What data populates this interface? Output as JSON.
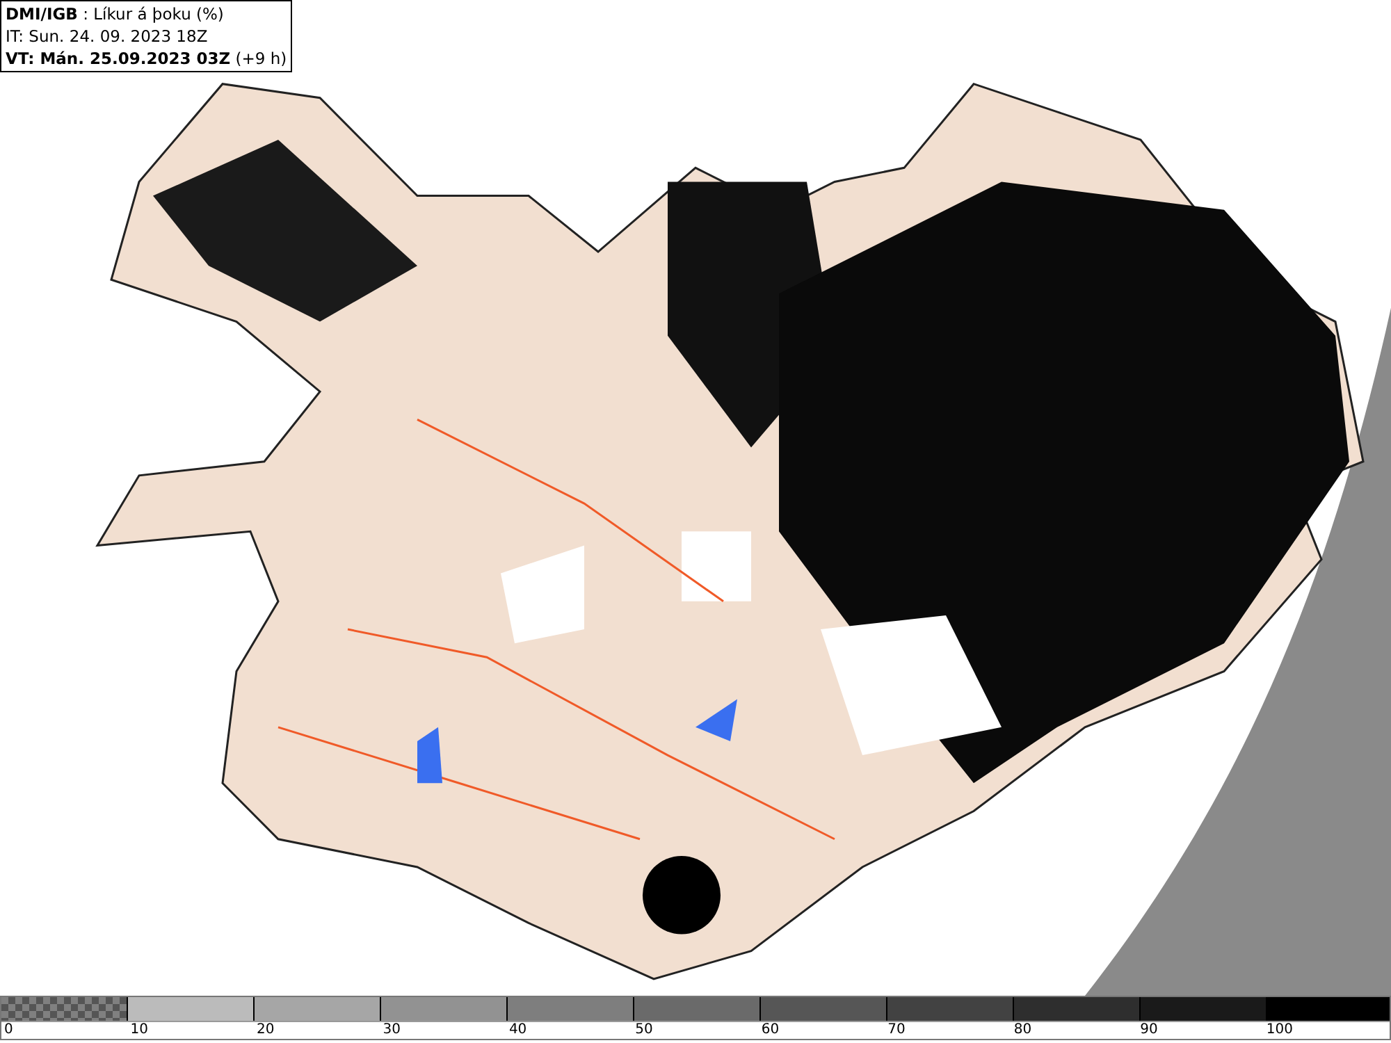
{
  "header": {
    "lines": [
      "**DMI/IGB** : Líkur á þoku (%)",
      "IT: Sun. 24. 09. 2023 18Z",
      "**VT: Mán. 25.09.2023 03Z** (+9 h)"
    ]
  },
  "legend": {
    "segments": [
      {
        "kind": "checker",
        "color": "#808080"
      },
      {
        "kind": "solid",
        "color": "#bbbbbb"
      },
      {
        "kind": "solid",
        "color": "#a6a6a6"
      },
      {
        "kind": "solid",
        "color": "#929292"
      },
      {
        "kind": "solid",
        "color": "#7e7e7e"
      },
      {
        "kind": "solid",
        "color": "#6a6a6a"
      },
      {
        "kind": "solid",
        "color": "#565656"
      },
      {
        "kind": "solid",
        "color": "#424242"
      },
      {
        "kind": "solid",
        "color": "#2e2e2e"
      },
      {
        "kind": "solid",
        "color": "#1a1a1a"
      },
      {
        "kind": "solid",
        "color": "#000000"
      }
    ],
    "labels": [
      "0",
      "10",
      "20",
      "30",
      "40",
      "50",
      "60",
      "70",
      "80",
      "90",
      "100"
    ]
  }
}
